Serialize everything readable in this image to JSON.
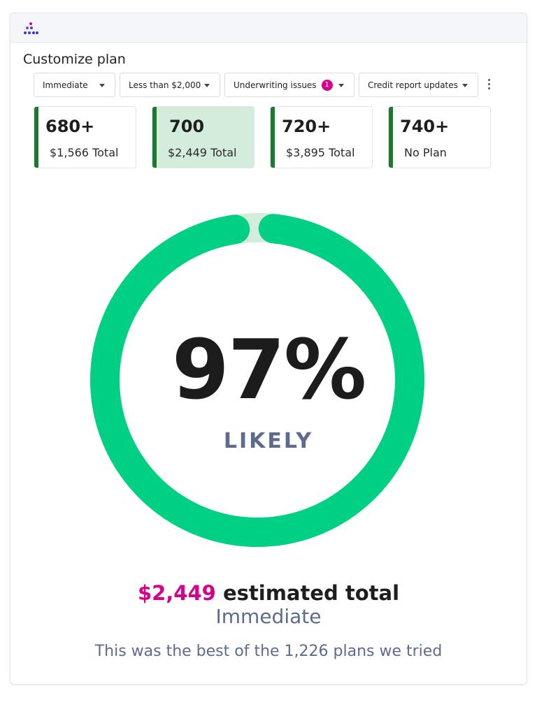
{
  "page": {
    "title": "Customize plan"
  },
  "filters": [
    {
      "label": "Immediate"
    },
    {
      "label": "Less than $2,000"
    },
    {
      "label": "Underwriting issues",
      "badge": "1"
    },
    {
      "label": "Credit report updates"
    }
  ],
  "tiers": [
    {
      "score": "680+",
      "total": "$1,566 Total",
      "selected": false
    },
    {
      "score": "700",
      "total": "$2,449 Total",
      "selected": true
    },
    {
      "score": "720+",
      "total": "$3,895 Total",
      "selected": false
    },
    {
      "score": "740+",
      "total": "No Plan",
      "selected": false
    }
  ],
  "gauge": {
    "percent_label": "97%",
    "status": "LIKELY",
    "fill_fraction": 0.97
  },
  "summary": {
    "amount": "$2,449",
    "amount_suffix": "estimated total",
    "timeline": "Immediate",
    "note": "This was the best of the 1,226 plans we tried"
  },
  "colors": {
    "accent": "#d6008c",
    "gauge": "#00d084",
    "gauge_track": "#d3ecdb",
    "tier_bar": "#1b7a2e",
    "muted": "#5d6b8f"
  },
  "icons": {
    "logo": "dots-logo-icon",
    "more": "more-vertical-icon",
    "dropdown": "chevron-down-icon"
  }
}
